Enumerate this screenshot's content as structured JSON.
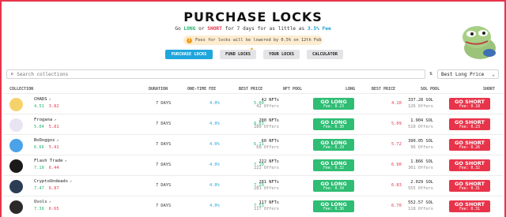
{
  "title": "PURCHASE LOCKS",
  "subtitle": {
    "go": "Go",
    "long": "LONG",
    "or": "or",
    "short": "SHORT",
    "mid": "for 7 days for as little as",
    "fee": "3.5% Fee"
  },
  "notice": "Fees for locks will be lowered by 0.5% on 12th Feb",
  "tabs": [
    "PURCHASE LOCKS",
    "FUND LOCKS",
    "YOUR LOCKS",
    "CALCULATOR"
  ],
  "search": {
    "placeholder": "Search collections"
  },
  "sort": {
    "selected": "Best Long Price"
  },
  "columns": {
    "collection": "COLLECTION",
    "duration": "DURATION",
    "fee": "ONE-TIME FEE",
    "best_price": "BEST PRICE",
    "nft_pool": "NFT POOL",
    "long": "LONG",
    "best_price2": "BEST PRICE",
    "sol_pool": "SOL POOL",
    "short": "SHORT"
  },
  "rows": [
    {
      "name": "CHADS",
      "v1": "4.51",
      "v2": "3.82",
      "duration": "7 DAYS",
      "fee": "4.0%",
      "best_long": "5.00",
      "nfts": "42 NFTs",
      "offers": "42 Offers",
      "long_label": "GO LONG",
      "long_fee": "Fee: 0.23",
      "best_short": "4.10",
      "sol": "337.28 SOL",
      "sol_offers": "126 Offers",
      "short_label": "GO SHORT",
      "short_fee": "Fee: 0.18",
      "avatar_color": "#f6d36a"
    },
    {
      "name": "Frogana",
      "v1": "5.04",
      "v2": "5.81",
      "duration": "7 DAYS",
      "fee": "4.0%",
      "best_long": "8.03",
      "nfts": "280 NFTs",
      "offers": "280 Offers",
      "long_label": "GO LONG",
      "long_fee": "Fee: 0.30",
      "best_short": "5.09",
      "sol": "1.904 SOL",
      "sol_offers": "510 Offers",
      "short_label": "GO SHORT",
      "short_fee": "Fee: 0.23",
      "avatar_color": "#e8e4f4"
    },
    {
      "name": "BoDoggos",
      "v1": "6.66",
      "v2": "5.41",
      "duration": "7 DAYS",
      "fee": "4.0%",
      "best_long": "6.11",
      "nfts": "60 NFTs",
      "offers": "60 Offers",
      "long_label": "GO LONG",
      "long_fee": "Fee: 0.29",
      "best_short": "5.72",
      "sol": "390.05 SOL",
      "sol_offers": "96 Offers",
      "short_label": "GO SHORT",
      "short_fee": "Fee: 0.26",
      "avatar_color": "#4aa3e8"
    },
    {
      "name": "Flash Trade",
      "v1": "7.10",
      "v2": "6.44",
      "duration": "7 DAYS",
      "fee": "4.0%",
      "best_long": "7.10",
      "nfts": "222 NFTs",
      "offers": "222 Offers",
      "long_label": "GO LONG",
      "long_fee": "Fee: 0.32",
      "best_short": "6.90",
      "sol": "1.866 SOL",
      "sol_offers": "301 Offers",
      "short_label": "GO SHORT",
      "short_fee": "Fee: 0.32",
      "avatar_color": "#1a1a1a"
    },
    {
      "name": "CryptoUndeads",
      "v1": "7.47",
      "v2": "6.87",
      "duration": "7 DAYS",
      "fee": "4.0%",
      "best_long": "7.29",
      "nfts": "281 NFTs",
      "offers": "281 Offers",
      "long_label": "GO LONG",
      "long_fee": "Fee: 0.34",
      "best_short": "6.83",
      "sol": "2.029 SOL",
      "sol_offers": "555 Offers",
      "short_label": "GO SHORT",
      "short_fee": "Fee: 0.31",
      "avatar_color": "#2b3d55"
    },
    {
      "name": "Ovols",
      "v1": "7.36",
      "v2": "6.65",
      "duration": "7 DAYS",
      "fee": "4.0%",
      "best_long": "7.53",
      "nfts": "117 NFTs",
      "offers": "117 Offers",
      "long_label": "GO LONG",
      "long_fee": "Fee: 0.36",
      "best_short": "6.70",
      "sol": "552.57 SOL",
      "sol_offers": "118 Offers",
      "short_label": "GO SHORT",
      "short_fee": "Fee: 0.31",
      "avatar_color": "#2a2a2a"
    }
  ]
}
